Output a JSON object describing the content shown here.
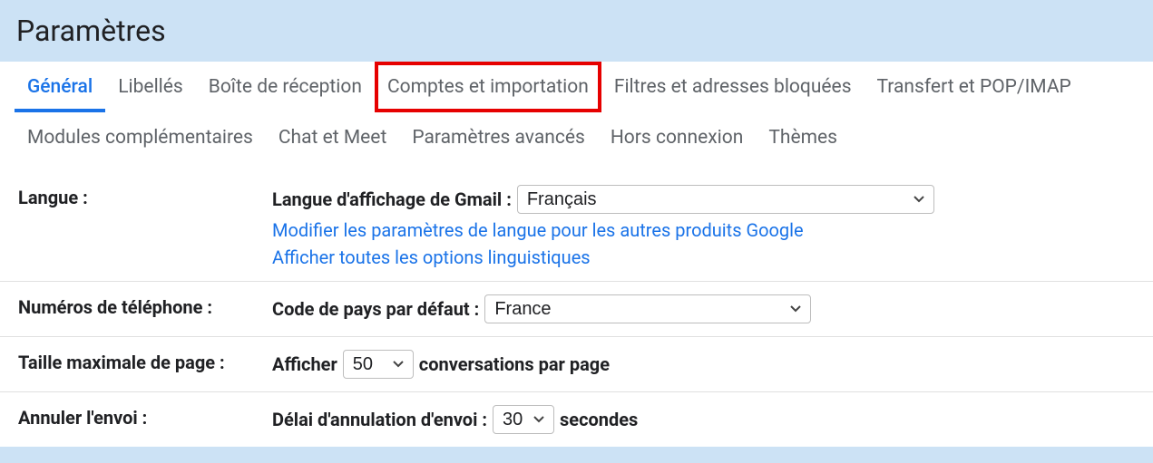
{
  "header": {
    "title": "Paramètres"
  },
  "tabs": {
    "row1": [
      {
        "label": "Général",
        "name": "tab-general",
        "active": true
      },
      {
        "label": "Libellés",
        "name": "tab-labels"
      },
      {
        "label": "Boîte de réception",
        "name": "tab-inbox"
      },
      {
        "label": "Comptes et importation",
        "name": "tab-accounts-import",
        "highlighted": true
      },
      {
        "label": "Filtres et adresses bloquées",
        "name": "tab-filters"
      },
      {
        "label": "Transfert et POP/IMAP",
        "name": "tab-forwarding"
      }
    ],
    "row2": [
      {
        "label": "Modules complémentaires",
        "name": "tab-addons"
      },
      {
        "label": "Chat et Meet",
        "name": "tab-chat"
      },
      {
        "label": "Paramètres avancés",
        "name": "tab-advanced"
      },
      {
        "label": "Hors connexion",
        "name": "tab-offline"
      },
      {
        "label": "Thèmes",
        "name": "tab-themes"
      }
    ]
  },
  "settings": {
    "language": {
      "label": "Langue :",
      "display_label": "Langue d'affichage de Gmail :",
      "value": "Français",
      "link1": "Modifier les paramètres de langue pour les autres produits Google",
      "link2": "Afficher toutes les options linguistiques"
    },
    "phone": {
      "label": "Numéros de téléphone :",
      "display_label": "Code de pays par défaut :",
      "value": "France"
    },
    "pagesize": {
      "label": "Taille maximale de page :",
      "prefix": "Afficher",
      "value": "50",
      "suffix": "conversations par page"
    },
    "undo": {
      "label": "Annuler l'envoi :",
      "prefix": "Délai d'annulation d'envoi :",
      "value": "30",
      "suffix": "secondes"
    }
  }
}
